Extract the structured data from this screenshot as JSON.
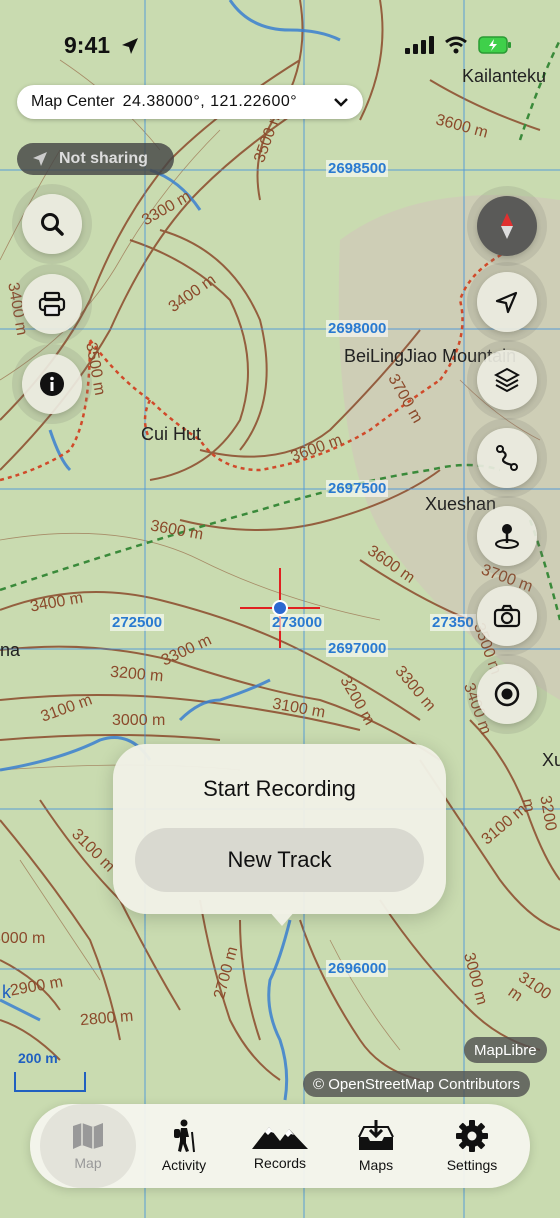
{
  "status": {
    "time": "9:41"
  },
  "map_center": {
    "label": "Map Center",
    "value": "24.38000°, 121.22600°"
  },
  "sharing": {
    "label": "Not sharing"
  },
  "map_labels": {
    "place_kailan": "Kailanteku",
    "place_beilingjiao": "BeiLingJiao Mountain",
    "place_cuihut": "Cui Hut",
    "place_xueshan": "Xueshan",
    "place_ma": "na",
    "place_xu": "Xu",
    "place_k": "k",
    "grid_y1": "2698500",
    "grid_y2": "2698000",
    "grid_y3": "2697500",
    "grid_y4": "2697000",
    "grid_y5": "2696000",
    "grid_x1": "272500",
    "grid_x2": "273000",
    "grid_x3": "27350",
    "c1": "3500 m",
    "c2": "3300 m",
    "c3": "3400 m",
    "c4": "3600 m",
    "c5": "3700 m",
    "c6": "3600 m",
    "c7": "3600 m",
    "c8": "3400 m",
    "c9": "3300 m",
    "c10": "3200 m",
    "c11": "3100 m",
    "c12": "3000 m",
    "c13": "3100 m",
    "c14": "3200 m",
    "c15": "3300 m",
    "c16": "3400 m",
    "c17": "3100 m",
    "c18": "3100 m",
    "c19": "2900 m",
    "c20": "2800 m",
    "c21": "2700 m",
    "c22": "3000 m",
    "c23": "3100 m",
    "c24": "3200 m",
    "c25": "3700 m",
    "c26": "3500 m",
    "c27": "3400 m",
    "c28": "3500 m",
    "c29": "3000 m",
    "c30": "3600 m"
  },
  "popup": {
    "title": "Start Recording",
    "button": "New Track"
  },
  "attribution": {
    "maplibre": "MapLibre",
    "osm": "© OpenStreetMap Contributors"
  },
  "scale": {
    "label": "200 m"
  },
  "tabs": [
    {
      "label": "Map",
      "icon": "map-icon",
      "active": true
    },
    {
      "label": "Activity",
      "icon": "hiker-icon"
    },
    {
      "label": "Records",
      "icon": "mountains-icon"
    },
    {
      "label": "Maps",
      "icon": "download-tray-icon"
    },
    {
      "label": "Settings",
      "icon": "gear-icon"
    }
  ],
  "colors": {
    "contour": "#8b4a2b",
    "grid": "#3a8ee0",
    "trail": "#d04a2a",
    "river": "#3a7fd0",
    "background": "#c9dbb0"
  }
}
